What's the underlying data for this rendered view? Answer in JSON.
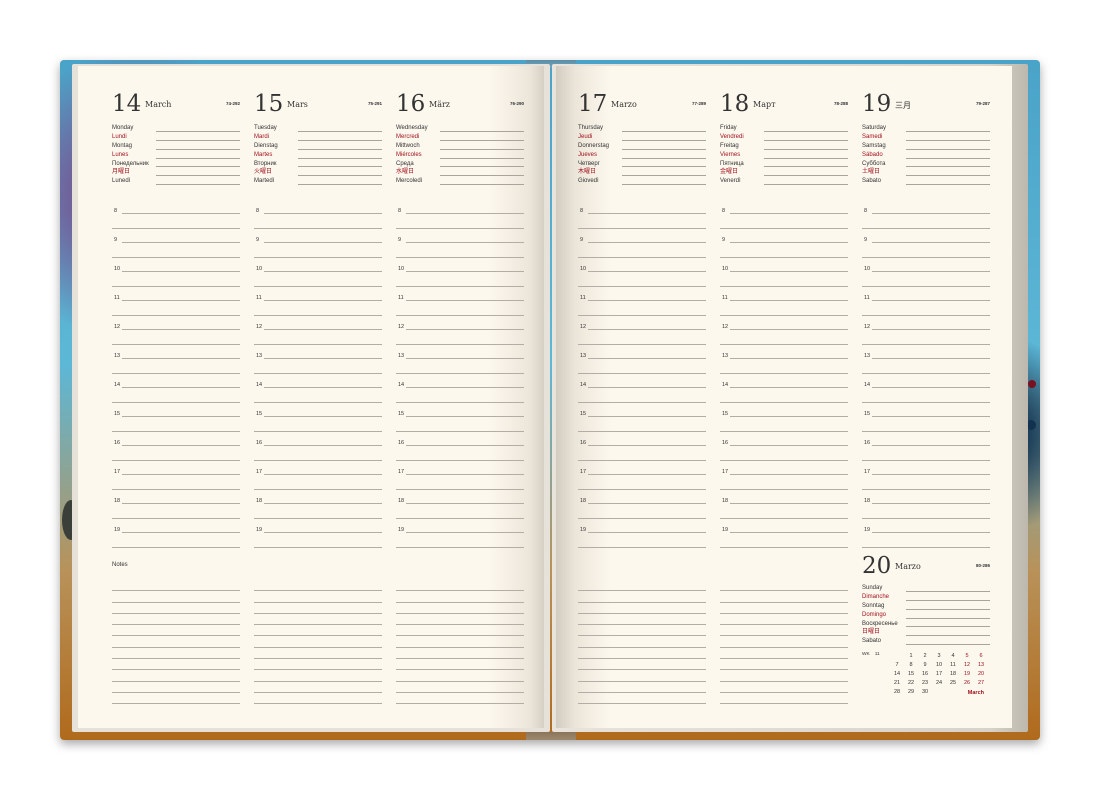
{
  "left_page": {
    "days": [
      {
        "number": "14",
        "month": "March",
        "count": "74-292",
        "names": [
          "Monday",
          "Lundi",
          "Montag",
          "Lunes",
          "Понедельник",
          "月曜日",
          "Lunedì"
        ],
        "red": [
          false,
          true,
          false,
          true,
          false,
          true,
          false
        ]
      },
      {
        "number": "15",
        "month": "Mars",
        "count": "75-291",
        "names": [
          "Tuesday",
          "Mardi",
          "Dienstag",
          "Martes",
          "Вторник",
          "火曜日",
          "Martedì"
        ],
        "red": [
          false,
          true,
          false,
          true,
          false,
          true,
          false
        ]
      },
      {
        "number": "16",
        "month": "März",
        "count": "76-290",
        "names": [
          "Wednesday",
          "Mercredi",
          "Mittwoch",
          "Miércoles",
          "Среда",
          "水曜日",
          "Mercoledì"
        ],
        "red": [
          false,
          true,
          false,
          true,
          false,
          true,
          false
        ]
      }
    ],
    "notes_label": "Notes"
  },
  "right_page": {
    "days": [
      {
        "number": "17",
        "month": "Marzo",
        "count": "77-289",
        "names": [
          "Thursday",
          "Jeudi",
          "Donnerstag",
          "Jueves",
          "Четверг",
          "木曜日",
          "Giovedì"
        ],
        "red": [
          false,
          true,
          false,
          true,
          false,
          true,
          false
        ]
      },
      {
        "number": "18",
        "month": "Март",
        "count": "78-288",
        "names": [
          "Friday",
          "Vendredi",
          "Freitag",
          "Viernes",
          "Пятница",
          "金曜日",
          "Venerdì"
        ],
        "red": [
          false,
          true,
          false,
          true,
          false,
          true,
          false
        ]
      },
      {
        "number": "19",
        "month": "三月",
        "count": "79-287",
        "names": [
          "Saturday",
          "Samedi",
          "Samstag",
          "Sábado",
          "Суббота",
          "土曜日",
          "Sabato"
        ],
        "red": [
          false,
          true,
          false,
          true,
          false,
          true,
          false
        ]
      }
    ],
    "sunday": {
      "number": "20",
      "month": "Marzo",
      "count": "80-286",
      "names": [
        "Sunday",
        "Dimanche",
        "Sonntag",
        "Domingo",
        "Воскресенье",
        "日曜日",
        "Sabato"
      ],
      "red": [
        false,
        true,
        false,
        true,
        false,
        true,
        false
      ]
    }
  },
  "hours": [
    "8",
    "9",
    "10",
    "11",
    "12",
    "13",
    "14",
    "15",
    "16",
    "17",
    "18",
    "19"
  ],
  "mini_calendar": {
    "week_label": "WK",
    "week_number": "11",
    "month": "March",
    "rows": [
      [
        "",
        "1",
        "2",
        "3",
        "4",
        "5",
        "6"
      ],
      [
        "7",
        "8",
        "9",
        "10",
        "11",
        "12",
        "13"
      ],
      [
        "14",
        "15",
        "16",
        "17",
        "18",
        "19",
        "20"
      ],
      [
        "21",
        "22",
        "23",
        "24",
        "25",
        "26",
        "27"
      ],
      [
        "28",
        "29",
        "30",
        "",
        "",
        "",
        ""
      ]
    ],
    "colors": {
      "weekend": "#a0101c"
    }
  },
  "colors": {
    "accent_red": "#a0101c",
    "paper": "#fdf8ee"
  }
}
